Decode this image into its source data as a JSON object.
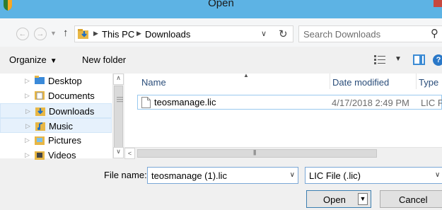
{
  "window": {
    "title": "Open"
  },
  "address": {
    "crumbs": [
      "This PC",
      "Downloads"
    ],
    "search_placeholder": "Search Downloads"
  },
  "toolbar": {
    "organize": "Organize",
    "new_folder": "New folder"
  },
  "nav": {
    "items": [
      {
        "label": "Desktop",
        "icon": "desktop-icon",
        "selected": false
      },
      {
        "label": "Documents",
        "icon": "documents-icon",
        "selected": false
      },
      {
        "label": "Downloads",
        "icon": "downloads-icon",
        "selected": true
      },
      {
        "label": "Music",
        "icon": "music-icon",
        "selected": true
      },
      {
        "label": "Pictures",
        "icon": "pictures-icon",
        "selected": false
      },
      {
        "label": "Videos",
        "icon": "videos-icon",
        "selected": false
      }
    ]
  },
  "list": {
    "columns": {
      "name": "Name",
      "date": "Date modified",
      "type": "Type"
    },
    "files": [
      {
        "name": "teosmanage.lic",
        "date": "4/17/2018 2:49 PM",
        "type": "LIC Fil"
      }
    ]
  },
  "bottom": {
    "filename_label": "File name:",
    "filename_value": "teosmanage (1).lic",
    "filter_value": "LIC File (.lic)",
    "open_label": "Open",
    "cancel_label": "Cancel"
  },
  "colors": {
    "titlebar": "#5db3e4",
    "selection": "#e6f1fc",
    "accent": "#3c7fb1"
  }
}
